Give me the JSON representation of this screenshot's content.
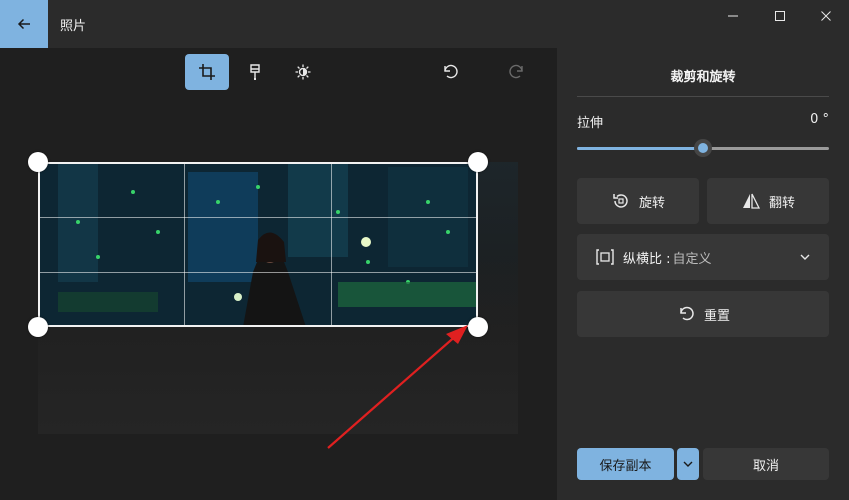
{
  "window": {
    "title": "照片",
    "controls": {
      "minimize": "minimize-icon",
      "maximize": "maximize-icon",
      "close": "close-icon"
    }
  },
  "toolbar": {
    "tools": [
      {
        "name": "crop",
        "icon": "crop-icon",
        "active": true
      },
      {
        "name": "filter",
        "icon": "brush-icon",
        "active": false
      },
      {
        "name": "adjust",
        "icon": "brightness-icon",
        "active": false
      }
    ],
    "undo_icon": "undo-icon",
    "redo_icon": "redo-icon"
  },
  "panel": {
    "title": "裁剪和旋转",
    "straighten": {
      "label": "拉伸",
      "value": "0 °",
      "level_fraction": 0.5
    },
    "rotate_label": "旋转",
    "flip_label": "翻转",
    "aspect": {
      "label": "纵横比 :",
      "value": "自定义"
    },
    "reset_label": "重置"
  },
  "footer": {
    "save_label": "保存副本",
    "cancel_label": "取消"
  },
  "colors": {
    "accent": "#7fb3e0",
    "annotation": "#e02020"
  }
}
